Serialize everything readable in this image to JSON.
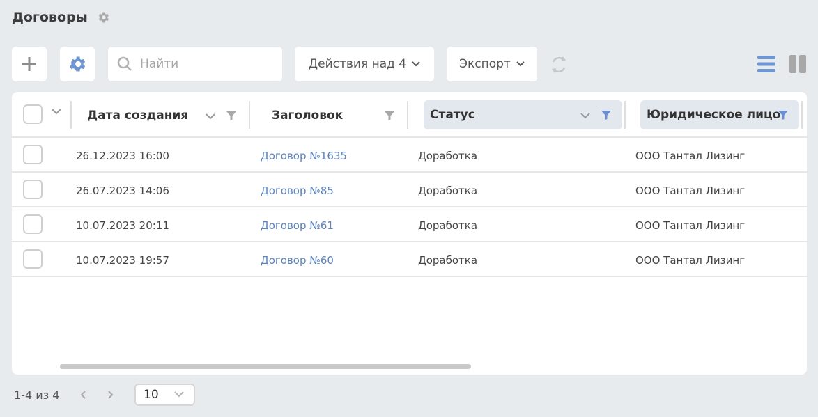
{
  "page": {
    "title": "Договоры"
  },
  "toolbar": {
    "search_placeholder": "Найти",
    "actions_label": "Действия над 4",
    "export_label": "Экспорт"
  },
  "table": {
    "columns": [
      {
        "label": "Дата создания",
        "filter_active": false
      },
      {
        "label": "Заголовок",
        "filter_active": false
      },
      {
        "label": "Статус",
        "filter_active": true
      },
      {
        "label": "Юридическое лицо",
        "filter_active": true
      }
    ],
    "rows": [
      {
        "date": "26.12.2023 16:00",
        "title": "Договор №1635",
        "status": "Доработка",
        "entity": "ООО Тантал Лизинг"
      },
      {
        "date": "26.07.2023 14:06",
        "title": "Договор №85",
        "status": "Доработка",
        "entity": "ООО Тантал Лизинг"
      },
      {
        "date": "10.07.2023 20:11",
        "title": "Договор №61",
        "status": "Доработка",
        "entity": "ООО Тантал Лизинг"
      },
      {
        "date": "10.07.2023 19:57",
        "title": "Договор №60",
        "status": "Доработка",
        "entity": "ООО Тантал Лизинг"
      }
    ]
  },
  "pagination": {
    "range": "1-4 из 4",
    "page_size": "10"
  },
  "colors": {
    "accent": "#5b82b9",
    "filter_active": "#6b8fd0",
    "icon_gray": "#8c8c8c",
    "background": "#e7ebee"
  }
}
